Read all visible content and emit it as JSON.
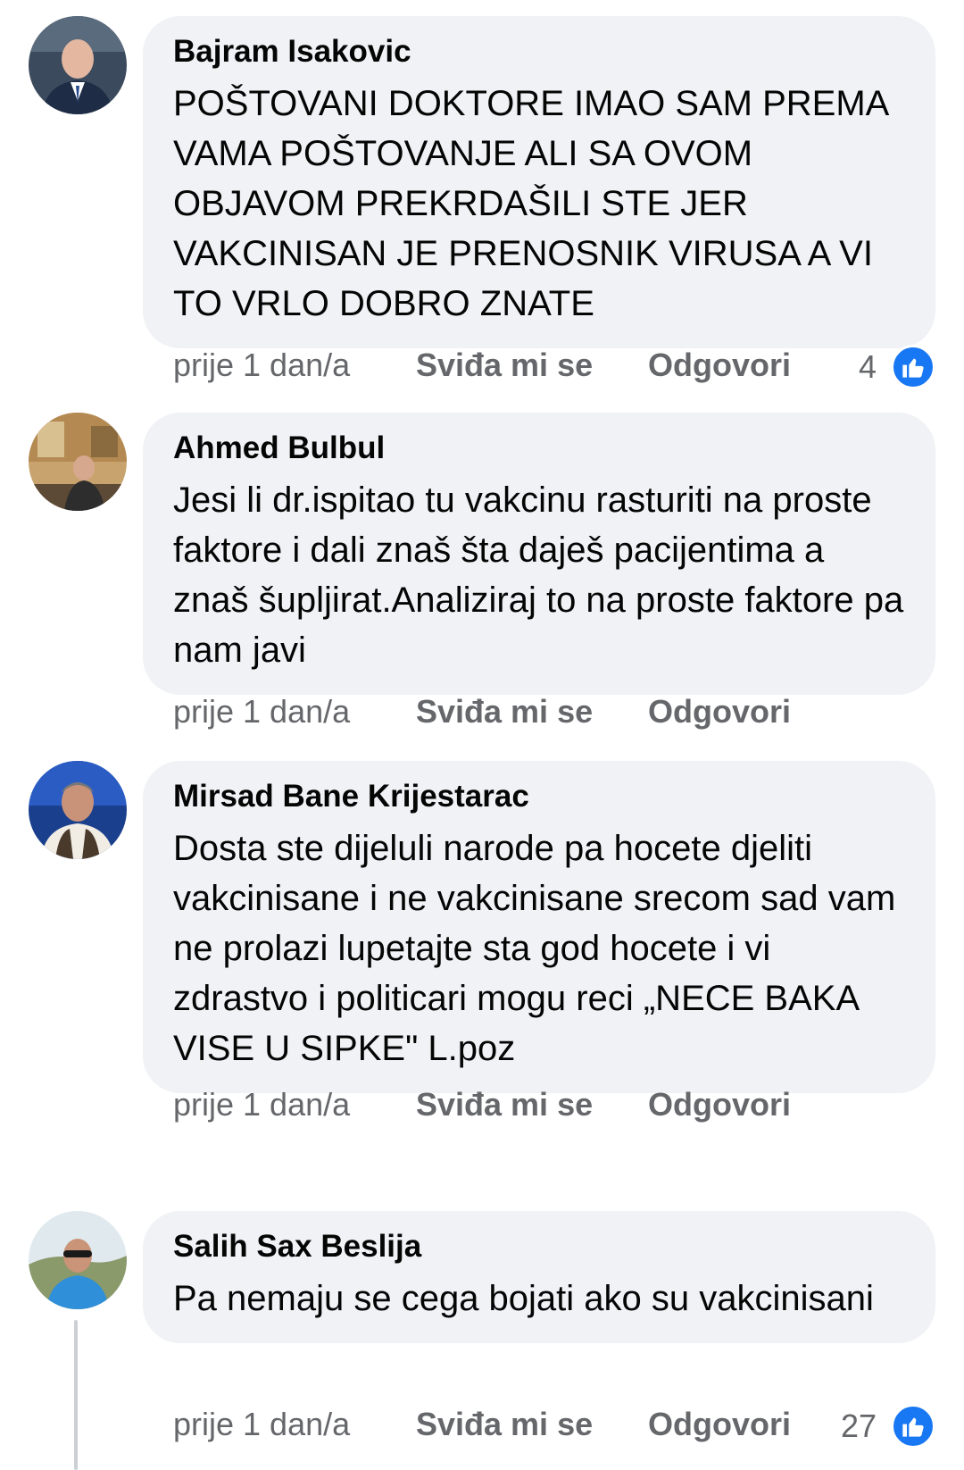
{
  "comments": [
    {
      "author": "Bajram Isakovic",
      "text": "POŠTOVANI DOKTORE IMAO SAM PREMA VAMA POŠTOVANJE ALI SA OVOM OBJAVOM PREKRDAŠILI STE JER VAKCINISAN JE PRENOSNIK VIRUSA A VI TO VRLO DOBRO ZNATE",
      "time": "prije 1 dan/a",
      "like_label": "Sviđa mi se",
      "reply_label": "Odgovori",
      "reaction_count": "4"
    },
    {
      "author": "Ahmed Bulbul",
      "text": "Jesi li dr.ispitao tu vakcinu rasturiti na proste faktore i dali znaš šta daješ pacijentima a znaš šupljirat.Analiziraj to na proste faktore pa nam javi",
      "time": "prije 1 dan/a",
      "like_label": "Sviđa mi se",
      "reply_label": "Odgovori"
    },
    {
      "author": "Mirsad Bane Krijestarac",
      "text": "Dosta ste dijeluli narode pa hocete djeliti vakcinisane i ne vakcinisane srecom sad vam ne prolazi lupetajte sta god hocete i vi zdrastvo i politicari mogu reci „NECE BAKA VISE U SIPKE\" L.poz",
      "time": "prije 1 dan/a",
      "like_label": "Sviđa mi se",
      "reply_label": "Odgovori"
    },
    {
      "author": "Salih Sax Beslija",
      "text": "Pa nemaju se cega bojati ako su vakcinisani",
      "time": "prije 1 dan/a",
      "like_label": "Sviđa mi se",
      "reply_label": "Odgovori",
      "reaction_count": "27"
    }
  ],
  "icons": {
    "reaction": "thumbs-up-icon",
    "avatar": "profile-photo"
  },
  "colors": {
    "bubble": "#f0f2f5",
    "meta_text": "#65676b",
    "like_blue": "#1877f2"
  }
}
